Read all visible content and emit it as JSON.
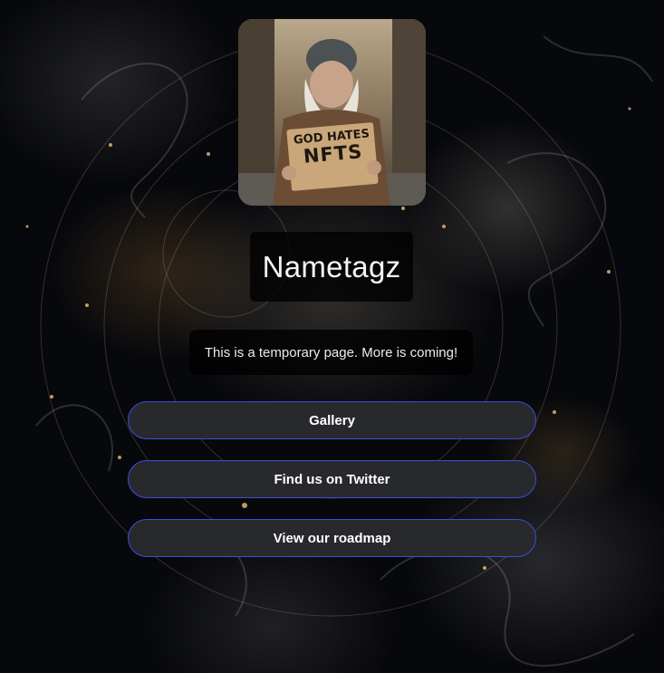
{
  "profile": {
    "title": "Nametagz",
    "note": "This is a temporary page. More is coming!",
    "avatar_sign_line1": "GOD HATES",
    "avatar_sign_line2": "NFTS"
  },
  "links": [
    {
      "label": "Gallery"
    },
    {
      "label": "Find us on Twitter"
    },
    {
      "label": "View our roadmap"
    }
  ],
  "colors": {
    "background": "#07080c",
    "button_fill": "#28292d",
    "button_border": "#3c4fd6",
    "text": "#ffffff"
  }
}
